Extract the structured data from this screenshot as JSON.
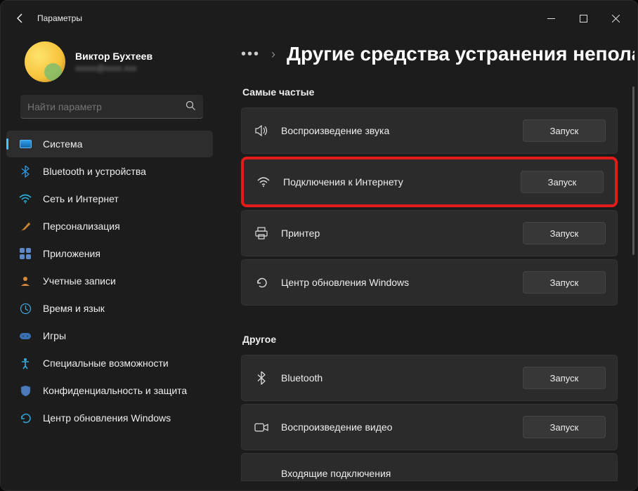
{
  "window": {
    "title": "Параметры"
  },
  "profile": {
    "name": "Виктор Бухтеев",
    "email": "xxxxx@xxxx.xxx"
  },
  "search": {
    "placeholder": "Найти параметр"
  },
  "sidebar": {
    "items": [
      {
        "label": "Система",
        "icon": "monitor-icon",
        "active": true
      },
      {
        "label": "Bluetooth и устройства",
        "icon": "bluetooth-icon"
      },
      {
        "label": "Сеть и Интернет",
        "icon": "wifi-icon"
      },
      {
        "label": "Персонализация",
        "icon": "brush-icon"
      },
      {
        "label": "Приложения",
        "icon": "apps-icon"
      },
      {
        "label": "Учетные записи",
        "icon": "person-icon"
      },
      {
        "label": "Время и язык",
        "icon": "clock-globe-icon"
      },
      {
        "label": "Игры",
        "icon": "gamepad-icon"
      },
      {
        "label": "Специальные возможности",
        "icon": "accessibility-icon"
      },
      {
        "label": "Конфиденциальность и защита",
        "icon": "shield-icon"
      },
      {
        "label": "Центр обновления Windows",
        "icon": "update-icon"
      }
    ]
  },
  "main": {
    "page_title": "Другие средства устранения непола",
    "run_label": "Запуск",
    "section_frequent": "Самые частые",
    "section_other": "Другое",
    "frequent": [
      {
        "label": "Воспроизведение звука",
        "icon": "speaker-icon"
      },
      {
        "label": "Подключения к Интернету",
        "icon": "wifi-icon",
        "highlight": true
      },
      {
        "label": "Принтер",
        "icon": "printer-icon"
      },
      {
        "label": "Центр обновления Windows",
        "icon": "refresh-icon"
      }
    ],
    "other": [
      {
        "label": "Bluetooth",
        "icon": "bluetooth-icon"
      },
      {
        "label": "Воспроизведение видео",
        "icon": "video-icon"
      },
      {
        "label": "Входящие подключения",
        "icon": "incoming-icon"
      }
    ]
  }
}
